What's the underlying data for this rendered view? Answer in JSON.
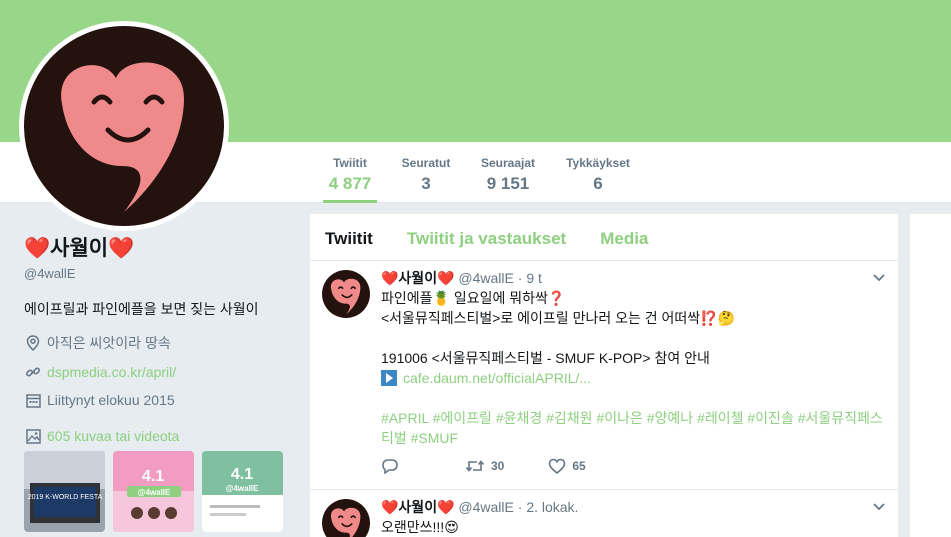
{
  "profile": {
    "name": "❤️사월이❤️",
    "handle": "@4wallE",
    "bio": "에이프릴과 파인에플을 보면 짖는 사월이",
    "location": "아직은 씨앗이라 땅속",
    "website": "dspmedia.co.kr/april/",
    "joined": "Liittynyt elokuu 2015",
    "media_link": "605 kuvaa tai videota"
  },
  "nav": [
    {
      "label": "Twiitit",
      "value": "4 877"
    },
    {
      "label": "Seuratut",
      "value": "3"
    },
    {
      "label": "Seuraajat",
      "value": "9 151"
    },
    {
      "label": "Tykkäykset",
      "value": "6"
    }
  ],
  "timeline_tabs": [
    "Twiitit",
    "Twiitit ja vastaukset",
    "Media"
  ],
  "tweets": [
    {
      "name": "❤️사월이❤️",
      "handle": "@4wallE",
      "time": "9 t",
      "line1": "파인에플🍍 일요일에 뭐하싹❓",
      "line2": "<서울뮤직페스티벌>로 에이프릴 만나러 오는 건 어떠싹⁉️🤔",
      "line3": "191006 <서울뮤직페스티벌 - SMUF K-POP> 참여 안내",
      "link": "cafe.daum.net/officialAPRIL/...",
      "hashtags": "#APRIL #에이프릴 #윤채경 #김채원 #이나은 #양예나 #레이첼 #이진솔 #서울뮤직페스티벌 #SMUF",
      "retweets": "30",
      "likes": "65"
    },
    {
      "name": "❤️사월이❤️",
      "handle": "@4wallE",
      "time": "2. lokak.",
      "line1": "오랜만쓰!!!😍"
    }
  ],
  "thumbs": [
    {
      "caption": "2019 K-WORLD FESTA"
    },
    {
      "caption": "@4wallE"
    },
    {
      "caption": "@4wallE"
    }
  ],
  "colors": {
    "accent": "#8ed080",
    "banner": "#98d78a",
    "avatar_bg": "#24120f",
    "heart": "#f08a8a"
  }
}
